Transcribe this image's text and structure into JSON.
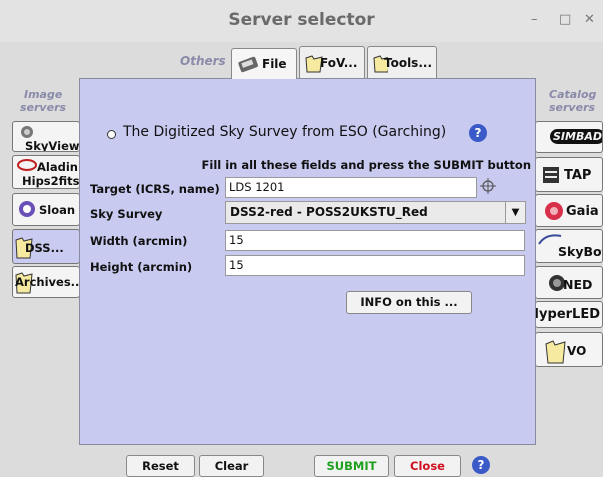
{
  "window": {
    "title": "Server selector",
    "minimize": "–",
    "maximize": "□",
    "close": "✕"
  },
  "tabs": {
    "others_label": "Others",
    "items": [
      {
        "label": "File",
        "icon": "file-icon"
      },
      {
        "label": "FoV...",
        "icon": "folder-icon"
      },
      {
        "label": "Tools...",
        "icon": "folder-icon"
      }
    ]
  },
  "left_sidebar": {
    "title_line1": "Image",
    "title_line2": "servers",
    "items": [
      {
        "label": "SkyView",
        "icon": "skyview-icon"
      },
      {
        "label": "Aladin",
        "label2": "Hips2fits",
        "icon": "aladin-icon"
      },
      {
        "label": "Sloan",
        "icon": "sloan-icon"
      },
      {
        "label": "DSS...",
        "icon": "folder-icon"
      },
      {
        "label": "Archives...",
        "icon": "folder-icon"
      }
    ]
  },
  "right_sidebar": {
    "title_line1": "Catalog",
    "title_line2": "servers",
    "items": [
      {
        "label": "SIMBAD",
        "icon": "simbad-icon"
      },
      {
        "label": "TAP",
        "icon": "tap-icon"
      },
      {
        "label": "Gaia",
        "icon": "gaia-icon"
      },
      {
        "label": "SkyBot",
        "icon": "skybot-icon"
      },
      {
        "label": "NED",
        "icon": "ned-icon"
      },
      {
        "label": "HyperLED",
        "icon": ""
      },
      {
        "label": "VO",
        "icon": "folder-icon"
      }
    ]
  },
  "form": {
    "heading": "The Digitized Sky Survey from ESO (Garching)",
    "instructions": "Fill in all these fields and press the SUBMIT button",
    "target_label": "Target (ICRS, name)",
    "target_value": "LDS 1201",
    "survey_label": "Sky Survey",
    "survey_value": "DSS2-red - POSS2UKSTU_Red",
    "width_label": "Width (arcmin)",
    "width_value": "15",
    "height_label": "Height (arcmin)",
    "height_value": "15",
    "info_button": "INFO on this ..."
  },
  "bottom": {
    "reset": "Reset",
    "clear": "Clear",
    "submit": "SUBMIT",
    "close": "Close",
    "submit_color": "#1fa01f",
    "close_color": "#d01020"
  },
  "colors": {
    "panel": "#c8caf0",
    "help": "#3a5ac8"
  }
}
